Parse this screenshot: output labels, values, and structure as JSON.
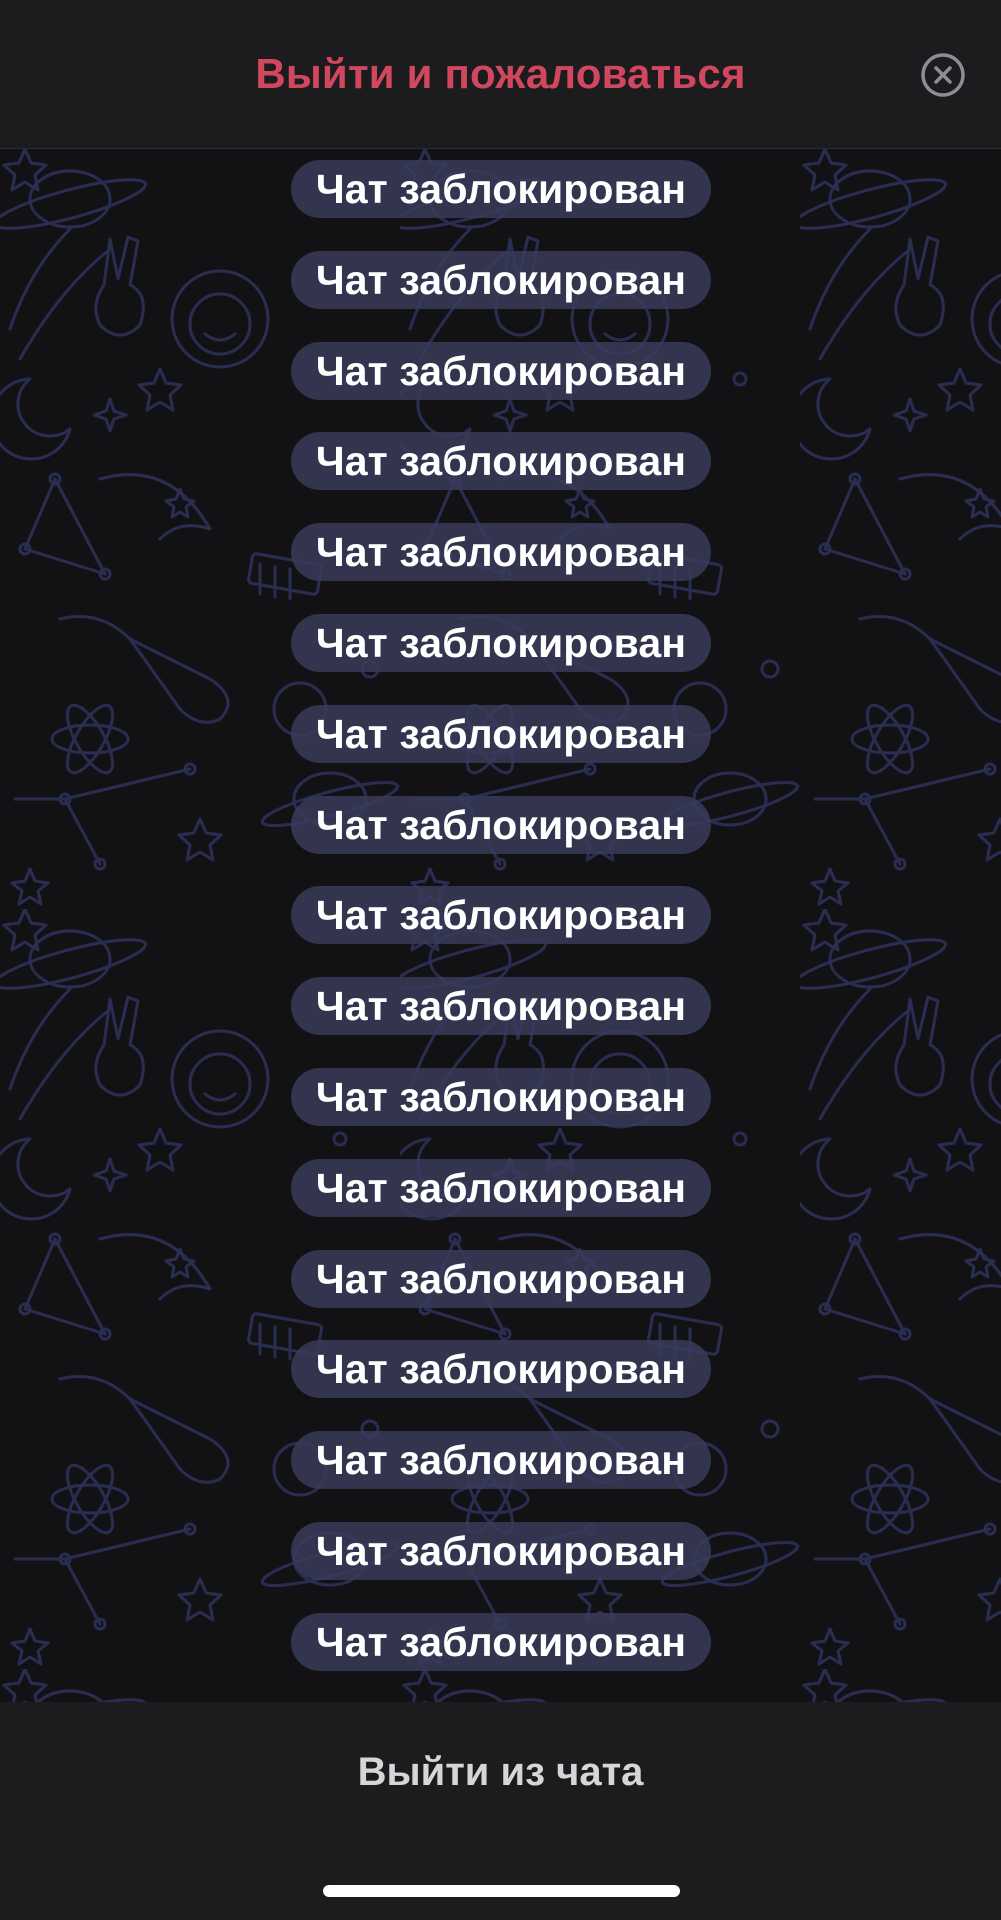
{
  "header": {
    "title": "Выйти и пожаловаться",
    "close_icon": "close-circle-icon",
    "title_color": "#d1475e"
  },
  "chat": {
    "background_pattern": "space-doodles-pattern",
    "messages": [
      "Чат заблокирован",
      "Чат заблокирован",
      "Чат заблокирован",
      "Чат заблокирован",
      "Чат заблокирован",
      "Чат заблокирован",
      "Чат заблокирован",
      "Чат заблокирован",
      "Чат заблокирован",
      "Чат заблокирован",
      "Чат заблокирован",
      "Чат заблокирован",
      "Чат заблокирован",
      "Чат заблокирован",
      "Чат заблокирован",
      "Чат заблокирован",
      "Чат заблокирован"
    ]
  },
  "footer": {
    "leave_label": "Выйти из чата"
  }
}
